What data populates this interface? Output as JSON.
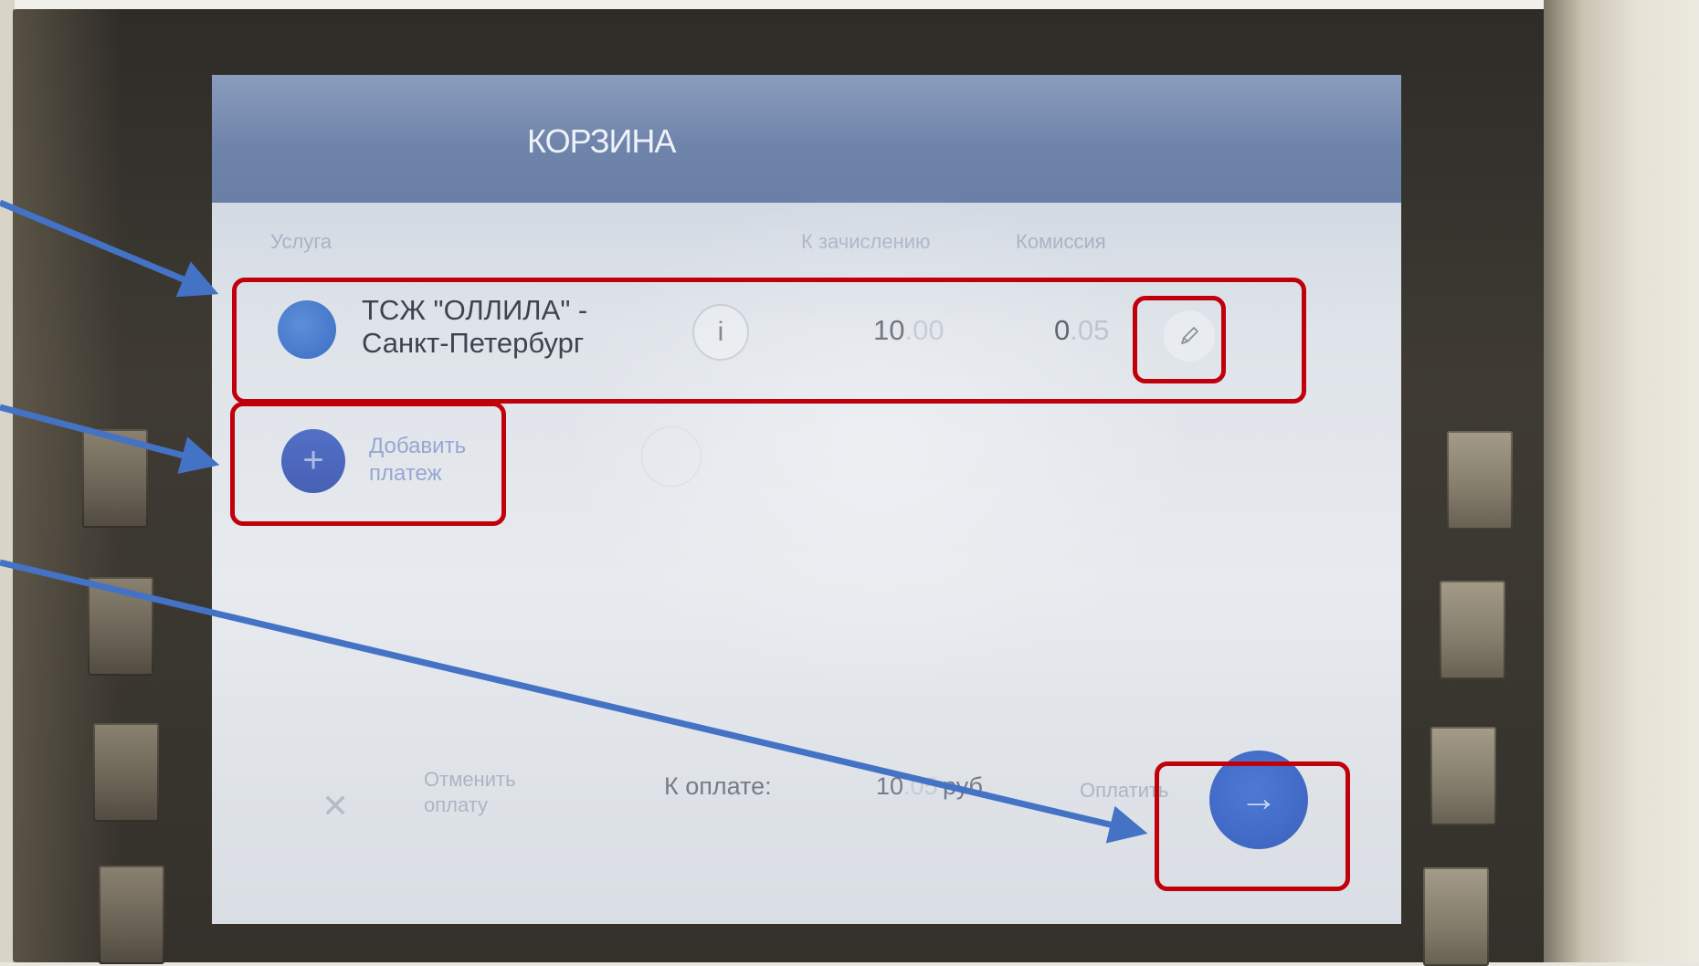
{
  "screen": {
    "title": "КОРЗИНА",
    "columns": {
      "service": "Услуга",
      "credit": "К зачислению",
      "fee": "Комиссия"
    },
    "payment_row": {
      "service_name": "ТСЖ \"ОЛЛИЛА\" - Санкт-Петербург",
      "info_label": "i",
      "credit_int": "10",
      "credit_frac": ".00",
      "fee_int": "0",
      "fee_frac": ".05",
      "edit_icon": "pencil-icon"
    },
    "add_payment": {
      "icon": "+",
      "label": "Добавить платеж"
    },
    "footer": {
      "cancel_icon": "✕",
      "cancel_label": "Отменить оплату",
      "total_label": "К оплате:",
      "total_int": "10",
      "total_frac": ".05",
      "currency": "руб.",
      "pay_label": "Оплатить",
      "next_icon": "→"
    }
  },
  "colors": {
    "highlight": "#c0000b",
    "arrow": "#4472c4",
    "accent": "#3a62bd"
  }
}
